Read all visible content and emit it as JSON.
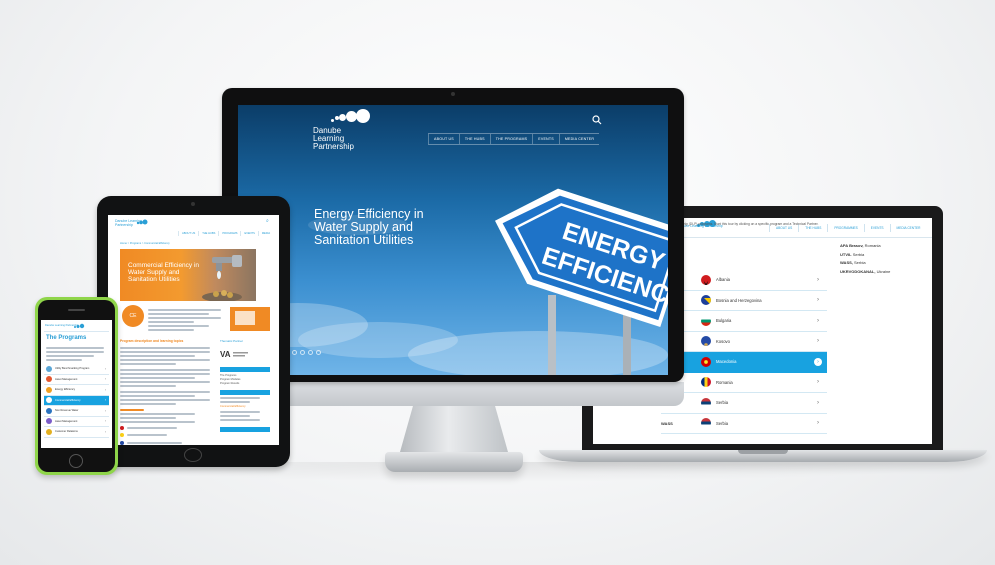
{
  "brand": {
    "name_line1": "Danube",
    "name_line2": "Learning",
    "name_line3": "Partnership",
    "accent_color": "#18a2e0",
    "orange_color": "#f08a24"
  },
  "monitor": {
    "nav": [
      "ABOUT US",
      "THE HUBS",
      "THE PROGRAMS",
      "EVENTS",
      "MEDIA CENTER"
    ],
    "hero_title": "Energy Efficiency in Water Supply and Sanitation Utilities",
    "sign_line1": "ENERGY",
    "sign_line2": "EFFICIENCY",
    "search_icon": "search-icon"
  },
  "laptop": {
    "logo_text": "Danube Learning Partnership",
    "nav": [
      "ABOUT US",
      "THE HUBS",
      "PROGRAMMES",
      "EVENTS",
      "MEDIA CENTER"
    ],
    "intro": "Partnership (DLP) programs. Start this tour by clicking on a specific program and a Technical Partner.",
    "countries": [
      {
        "code": "O",
        "name": "Albania",
        "active": false
      },
      {
        "code": "",
        "name": "Bosnia and Herzegovina",
        "active": false
      },
      {
        "code": "",
        "name": "Bulgaria",
        "active": false
      },
      {
        "code": "",
        "name": "Kosovo",
        "active": false
      },
      {
        "code": "",
        "name": "Macedonia",
        "active": true
      },
      {
        "code": "ran",
        "name": "Romania",
        "active": false
      },
      {
        "code": "",
        "name": "Serbia",
        "active": false
      },
      {
        "code": "WASS",
        "name": "Serbia",
        "active": false
      }
    ],
    "partners": [
      {
        "name": "APA Brasov,",
        "country": "Romania"
      },
      {
        "name": "UTVIL",
        "country": "Serbia"
      },
      {
        "name": "WASS,",
        "country": "Serbia"
      },
      {
        "name": "UKRVODOKANAL,",
        "country": "Ukraine"
      }
    ]
  },
  "tablet": {
    "logo_text": "Danube Learning Partnership",
    "nav": [
      "ABOUT US",
      "THE HUBS",
      "PROGRAMS",
      "EVENTS",
      "MEDIA"
    ],
    "breadcrumb": "Home > Programs > Commercial Efficiency",
    "banner_title": "Commercial Efficiency in Water Supply and Sanitation Utilities",
    "badge": "CE",
    "section_heading": "Program description and learning topics",
    "sidebar_title": "Thematic Partner",
    "sidebar_links": [
      "The Programs",
      "Program Modules",
      "Program Results",
      "Commercial Efficiency"
    ]
  },
  "phone": {
    "logo_text": "Danube Learning Partnership",
    "title": "The Programs",
    "programs": [
      {
        "label": "Utility Benchmarking Program",
        "color": "#5aa6d6",
        "active": false
      },
      {
        "label": "Asset Management",
        "color": "#e4572e",
        "active": false
      },
      {
        "label": "Energy Efficiency",
        "color": "#f0a020",
        "active": false
      },
      {
        "label": "Commercial Efficiency",
        "color": "#18a2e0",
        "active": true
      },
      {
        "label": "Non Revenue Water",
        "color": "#2a73c0",
        "active": false
      },
      {
        "label": "Asset Management",
        "color": "#7b5cc9",
        "active": false
      },
      {
        "label": "Customer Relations",
        "color": "#e3b020",
        "active": false
      }
    ]
  }
}
